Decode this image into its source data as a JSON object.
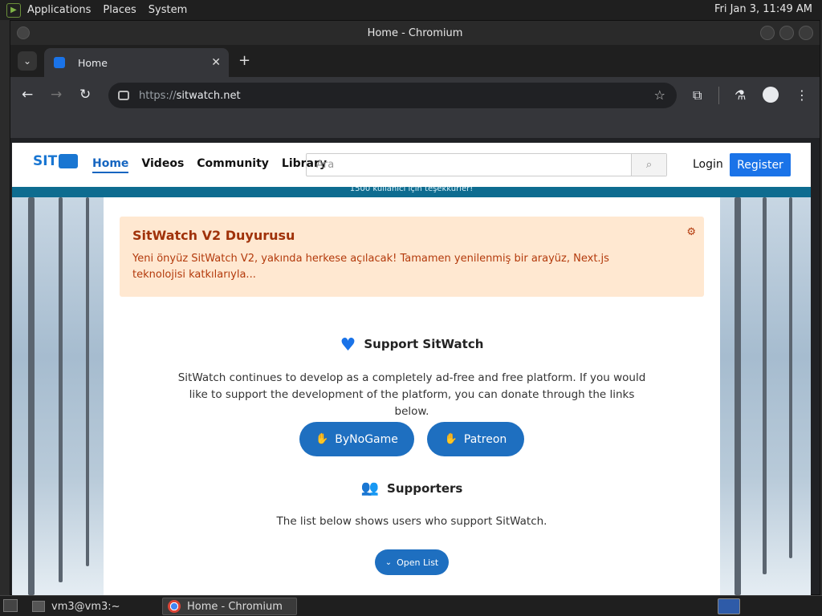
{
  "desktop": {
    "panel_menus": [
      "Applications",
      "Places",
      "System"
    ],
    "clock": "Fri Jan  3, 11:49 AM"
  },
  "window": {
    "title": "Home - Chromium"
  },
  "browser": {
    "tab_title": "Home",
    "url_scheme": "https://",
    "url_host": "sitwatch.net"
  },
  "site": {
    "logo_text": "SIT",
    "nav": [
      "Home",
      "Videos",
      "Community",
      "Library"
    ],
    "search_placeholder": "Ara",
    "login_label": "Login",
    "register_label": "Register",
    "ticker_text": "1500 kullanıcı için teşekkürler!"
  },
  "announcement": {
    "title": "SitWatch V2 Duyurusu",
    "body": "Yeni önyüz SitWatch V2, yakında herkese açılacak! Tamamen yenilenmiş bir arayüz, Next.js teknolojisi katkılarıyla..."
  },
  "support": {
    "title": "Support SitWatch",
    "description": "SitWatch continues to develop as a completely ad-free and free platform. If you would like to support the development of the platform, you can donate through the links below.",
    "buttons": [
      "ByNoGame",
      "Patreon"
    ]
  },
  "supporters": {
    "title": "Supporters",
    "description": "The list below shows users who support SitWatch.",
    "open_list_label": "Open List"
  },
  "taskbar": {
    "tasks": [
      "vm3@vm3:~",
      "Home - Chromium"
    ]
  },
  "colors": {
    "accent": "#1a73e8",
    "button_blue": "#1e6fc0",
    "announce_bg": "#ffe8d1",
    "announce_text": "#b33a0c",
    "ticker_bg": "#0e6c90"
  }
}
